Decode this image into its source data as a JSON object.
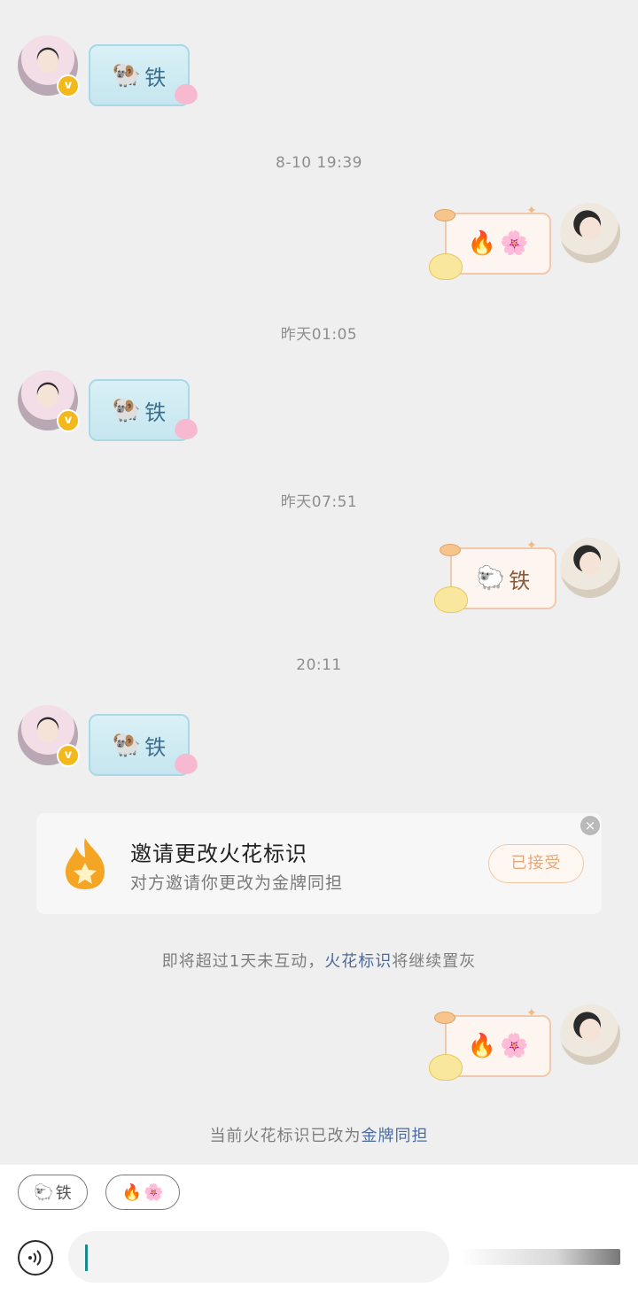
{
  "messages": [
    {
      "side": "them",
      "content": "🐏铁"
    },
    {
      "time": "8-10 19:39"
    },
    {
      "side": "me",
      "content": "🔥🌸"
    },
    {
      "time": "昨天01:05"
    },
    {
      "side": "them",
      "content": "🐏铁"
    },
    {
      "time": "昨天07:51"
    },
    {
      "side": "me",
      "content": "🐑铁"
    },
    {
      "time": "20:11"
    },
    {
      "side": "them",
      "content": "🐏铁"
    }
  ],
  "bubble_parts": {
    "ram": "🐏",
    "sheep": "🐑",
    "tie": "铁",
    "fire": "🔥",
    "blossom": "🌸"
  },
  "timestamps": {
    "t1": "8-10 19:39",
    "t2": "昨天01:05",
    "t3": "昨天07:51",
    "t4": "20:11"
  },
  "invite_card": {
    "title": "邀请更改火花标识",
    "subtitle": "对方邀请你更改为金牌同担",
    "button": "已接受",
    "close": "×"
  },
  "notices": {
    "warn_prefix": "即将超过1天未互动，",
    "warn_link": "火花标识",
    "warn_suffix": "将继续置灰",
    "changed_prefix": "当前火花标识已改为",
    "changed_link": "金牌同担"
  },
  "quick_replies": [
    {
      "emoji": "🐑",
      "text": "铁"
    },
    {
      "emoji": "🔥",
      "text": "🌸"
    }
  ],
  "input": {
    "value": "",
    "placeholder": ""
  },
  "icons": {
    "voice": "voice-icon",
    "verified": "verified-badge-icon",
    "close": "close-icon",
    "flame": "flame-star-icon"
  },
  "colors": {
    "link": "#4d6b9c",
    "accent_orange": "#f3a23a",
    "badge": "#f3b81b"
  }
}
